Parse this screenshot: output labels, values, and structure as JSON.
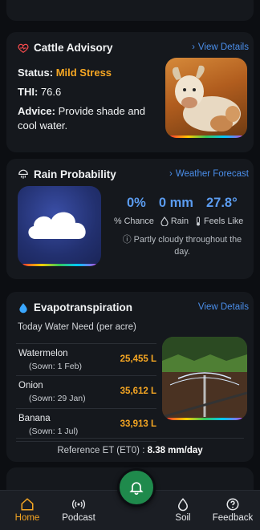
{
  "cattle": {
    "title": "Cattle Advisory",
    "link": "View Details",
    "status_label": "Status:",
    "status_value": "Mild Stress",
    "thi_label": "THI:",
    "thi_value": "76.6",
    "advice_label": "Advice:",
    "advice_value": "Provide shade and cool water.",
    "icon": "heart-pulse-icon",
    "status_color": "#f5a623"
  },
  "rain": {
    "title": "Rain Probability",
    "link": "Weather Forecast",
    "chance": "0%",
    "rain": "0 mm",
    "feels_like": "27.8°",
    "chance_label": "Chance",
    "rain_label": "Rain",
    "feels_label": "Feels Like",
    "note": "Partly cloudy throughout the day.",
    "icon": "umbrella-rain-icon"
  },
  "evapo": {
    "title": "Evapotranspiration",
    "link": "View Details",
    "subhead": "Today Water Need (per acre)",
    "crops": [
      {
        "name": "Watermelon",
        "sown": "(Sown: 1 Feb)",
        "value": "25,455 L"
      },
      {
        "name": "Onion",
        "sown": "(Sown: 29 Jan)",
        "value": "35,612 L"
      },
      {
        "name": "Banana",
        "sown": "(Sown: 1 Jul)",
        "value": "33,913 L"
      }
    ],
    "ref_label": "Reference ET (ET0) :",
    "ref_value": "8.38 mm/day",
    "icon": "water-drop-icon"
  },
  "nav": {
    "home": "Home",
    "podcast": "Podcast",
    "soil": "Soil",
    "feedback": "Feedback",
    "active_color": "#f5a623",
    "fab_color": "#1f8a4c"
  }
}
